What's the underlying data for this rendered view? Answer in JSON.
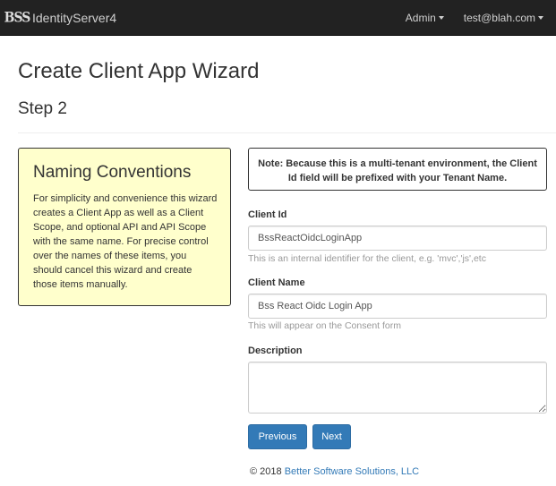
{
  "navbar": {
    "logo_text": "BSS",
    "brand": "IdentityServer4",
    "menu": [
      {
        "label": "Admin"
      },
      {
        "label": "test@blah.com"
      }
    ]
  },
  "page": {
    "title": "Create Client App Wizard",
    "step": "Step 2"
  },
  "naming": {
    "title": "Naming Conventions",
    "text": "For simplicity and convenience this wizard creates a Client App as well as a Client Scope, and optional API and API Scope with the same name. For precise control over the names of these items, you should cancel this wizard and create those items manually."
  },
  "note": "Note: Because this is a multi-tenant environment, the Client Id field will be prefixed with your Tenant Name.",
  "form": {
    "client_id": {
      "label": "Client Id",
      "value": "BssReactOidcLoginApp",
      "help": "This is an internal identifier for the client, e.g. 'mvc','js',etc"
    },
    "client_name": {
      "label": "Client Name",
      "value": "Bss React Oidc Login App",
      "help": "This will appear on the Consent form"
    },
    "description": {
      "label": "Description",
      "value": ""
    }
  },
  "buttons": {
    "previous": "Previous",
    "next": "Next"
  },
  "footer": {
    "copyright": "© 2018",
    "company": "Better Software Solutions, LLC"
  },
  "colors": {
    "navbar": "#222222",
    "primary": "#337ab7",
    "note_box": "#ffffcc"
  }
}
